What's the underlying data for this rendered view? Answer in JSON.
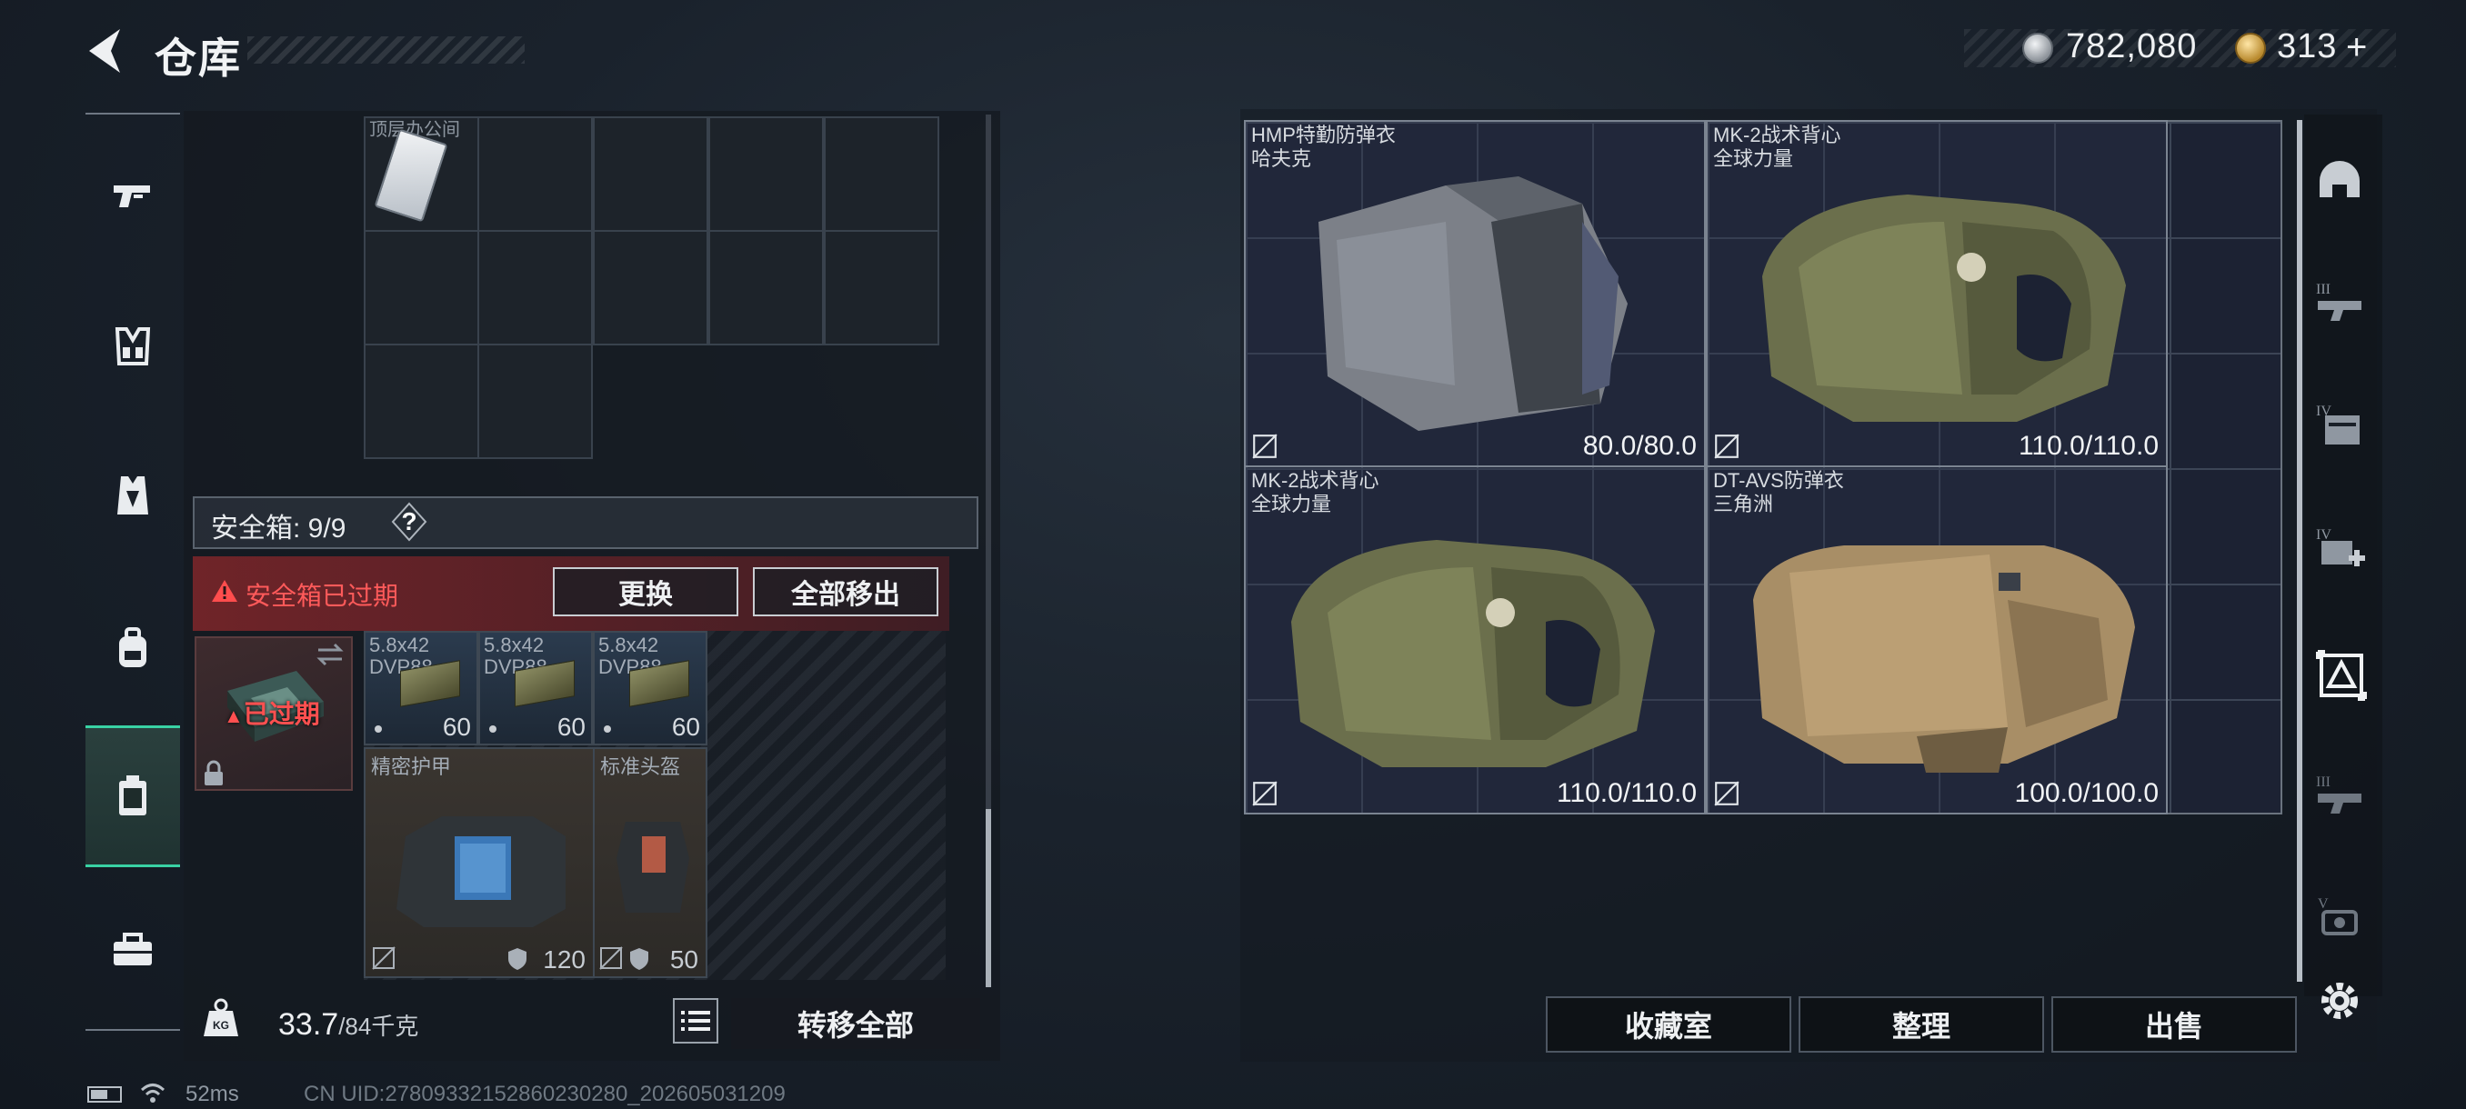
{
  "header": {
    "title": "仓库",
    "silver_amount": "782,080",
    "gold_amount": "313",
    "gold_plus": "+"
  },
  "nav": {
    "items": [
      {
        "name": "weapons",
        "icon": "pistol-icon"
      },
      {
        "name": "vest",
        "icon": "chest-rig-icon"
      },
      {
        "name": "armor",
        "icon": "armor-vest-icon"
      },
      {
        "name": "backpack",
        "icon": "backpack-icon"
      },
      {
        "name": "safebox",
        "icon": "safebox-icon",
        "active": true
      },
      {
        "name": "toolbox",
        "icon": "toolbox-icon"
      }
    ]
  },
  "storage": {
    "ceiling_item_label": "顶层办公间"
  },
  "safebox": {
    "label": "安全箱: 9/9",
    "help": "?",
    "expired_message": "安全箱已过期",
    "replace_label": "更换",
    "remove_all_label": "全部移出",
    "slot_expired_label": "已过期",
    "ammo": [
      {
        "name": "5.8x42 DVP88",
        "count": "60"
      },
      {
        "name": "5.8x42 DVP88",
        "count": "60"
      },
      {
        "name": "5.8x42 DVP88",
        "count": "60"
      }
    ],
    "gear": [
      {
        "name": "精密护甲",
        "value": "120"
      },
      {
        "name": "标准头盔",
        "value": "50"
      }
    ]
  },
  "footer": {
    "weight_current": "33.7",
    "weight_max": "/84千克",
    "transfer_all_label": "转移全部",
    "ping": "52ms",
    "uid": "CN UID:278093321528602302​80_202605031209"
  },
  "right_inventory": {
    "items": [
      {
        "name": "HMP特勤防弹衣",
        "brand": "哈夫克",
        "durability": "80.0/80.0",
        "color": "#7c8088"
      },
      {
        "name": "MK-2战术背心",
        "brand": "全球力量",
        "durability": "110.0/110.0",
        "color": "#6b6f4c"
      },
      {
        "name": "MK-2战术背心",
        "brand": "全球力量",
        "durability": "110.0/110.0",
        "color": "#6b6f4c"
      },
      {
        "name": "DT-AVS防弹衣",
        "brand": "三角洲",
        "durability": "100.0/100.0",
        "color": "#a88e66"
      }
    ],
    "collection_label": "收藏室",
    "organize_label": "整理",
    "sell_label": "出售"
  },
  "right_rail": {
    "icons": [
      "helmet-icon",
      "weapon-tier-3-icon",
      "case-tier-4-icon",
      "medkit-tier-4-icon",
      "armor-filter-icon",
      "weapon-tier-3b-icon",
      "gear-tier-5-icon"
    ]
  }
}
